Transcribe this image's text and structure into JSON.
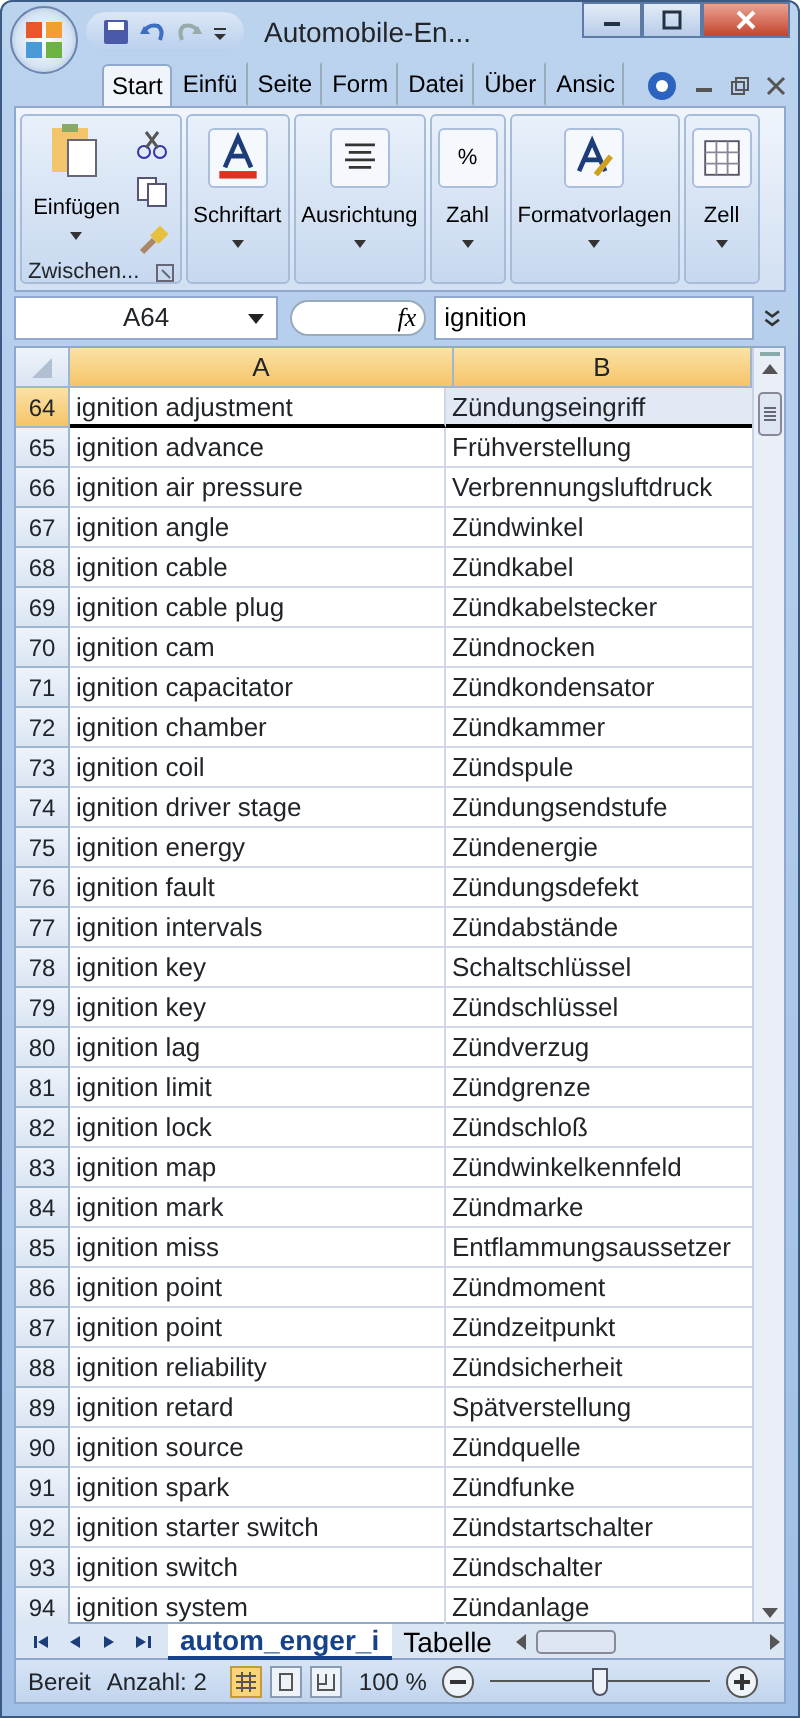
{
  "window": {
    "title": "Automobile-En..."
  },
  "tabs": [
    {
      "label": "Start",
      "selected": true
    },
    {
      "label": "Einfü",
      "selected": false
    },
    {
      "label": "Seite",
      "selected": false
    },
    {
      "label": "Form",
      "selected": false
    },
    {
      "label": "Datei",
      "selected": false
    },
    {
      "label": "Über",
      "selected": false
    },
    {
      "label": "Ansic",
      "selected": false
    }
  ],
  "ribbon": {
    "groups": [
      {
        "kind": "clipboard",
        "label": "Einfügen",
        "footer": "Zwischen..."
      },
      {
        "kind": "font",
        "label": "Schriftart"
      },
      {
        "kind": "align",
        "label": "Ausrichtung"
      },
      {
        "kind": "number",
        "label": "Zahl",
        "icon_text": "%"
      },
      {
        "kind": "styles",
        "label": "Formatvorlagen"
      },
      {
        "kind": "cells",
        "label": "Zell"
      }
    ]
  },
  "formula_bar": {
    "name_box": "A64",
    "fx": "fx",
    "value": "ignition"
  },
  "columns": [
    "A",
    "B"
  ],
  "rows": [
    {
      "number": "64",
      "a": "ignition adjustment",
      "b": "Zündungseingriff",
      "selected": true
    },
    {
      "number": "65",
      "a": "ignition advance",
      "b": "Frühverstellung",
      "selected": false
    },
    {
      "number": "66",
      "a": "ignition air pressure",
      "b": "Verbrennungsluftdruck",
      "selected": false
    },
    {
      "number": "67",
      "a": "ignition angle",
      "b": "Zündwinkel",
      "selected": false
    },
    {
      "number": "68",
      "a": "ignition cable",
      "b": "Zündkabel",
      "selected": false
    },
    {
      "number": "69",
      "a": "ignition cable plug",
      "b": "Zündkabelstecker",
      "selected": false
    },
    {
      "number": "70",
      "a": "ignition cam",
      "b": "Zündnocken",
      "selected": false
    },
    {
      "number": "71",
      "a": "ignition capacitator",
      "b": "Zündkondensator",
      "selected": false
    },
    {
      "number": "72",
      "a": "ignition chamber",
      "b": "Zündkammer",
      "selected": false
    },
    {
      "number": "73",
      "a": "ignition coil",
      "b": "Zündspule",
      "selected": false
    },
    {
      "number": "74",
      "a": "ignition driver stage",
      "b": "Zündungsendstufe",
      "selected": false
    },
    {
      "number": "75",
      "a": "ignition energy",
      "b": "Zündenergie",
      "selected": false
    },
    {
      "number": "76",
      "a": "ignition fault",
      "b": "Zündungsdefekt",
      "selected": false
    },
    {
      "number": "77",
      "a": "ignition intervals",
      "b": "Zündabstände",
      "selected": false
    },
    {
      "number": "78",
      "a": "ignition key",
      "b": "Schaltschlüssel",
      "selected": false
    },
    {
      "number": "79",
      "a": "ignition key",
      "b": "Zündschlüssel",
      "selected": false
    },
    {
      "number": "80",
      "a": "ignition lag",
      "b": "Zündverzug",
      "selected": false
    },
    {
      "number": "81",
      "a": "ignition limit",
      "b": "Zündgrenze",
      "selected": false
    },
    {
      "number": "82",
      "a": "ignition lock",
      "b": "Zündschloß",
      "selected": false
    },
    {
      "number": "83",
      "a": "ignition map",
      "b": "Zündwinkelkennfeld",
      "selected": false
    },
    {
      "number": "84",
      "a": "ignition mark",
      "b": "Zündmarke",
      "selected": false
    },
    {
      "number": "85",
      "a": "ignition miss",
      "b": "Entflammungsaussetzer",
      "selected": false
    },
    {
      "number": "86",
      "a": "ignition point",
      "b": "Zündmoment",
      "selected": false
    },
    {
      "number": "87",
      "a": "ignition point",
      "b": "Zündzeitpunkt",
      "selected": false
    },
    {
      "number": "88",
      "a": "ignition reliability",
      "b": "Zündsicherheit",
      "selected": false
    },
    {
      "number": "89",
      "a": "ignition retard",
      "b": "Spätverstellung",
      "selected": false
    },
    {
      "number": "90",
      "a": "ignition source",
      "b": "Zündquelle",
      "selected": false
    },
    {
      "number": "91",
      "a": "ignition spark",
      "b": "Zündfunke",
      "selected": false
    },
    {
      "number": "92",
      "a": "ignition starter switch",
      "b": "Zündstartschalter",
      "selected": false
    },
    {
      "number": "93",
      "a": "ignition switch",
      "b": "Zündschalter",
      "selected": false
    },
    {
      "number": "94",
      "a": "ignition system",
      "b": "Zündanlage",
      "selected": false
    }
  ],
  "sheet_tabs": [
    {
      "label": "autom_enger_i",
      "selected": true
    },
    {
      "label": "Tabelle",
      "selected": false
    }
  ],
  "status_bar": {
    "items": [
      "Bereit",
      "Anzahl: 2"
    ],
    "views": [
      {
        "selected": true
      },
      {
        "selected": false
      },
      {
        "selected": false
      }
    ],
    "zoom": "100 %",
    "zoom_slider": {
      "level": 0.5
    }
  }
}
